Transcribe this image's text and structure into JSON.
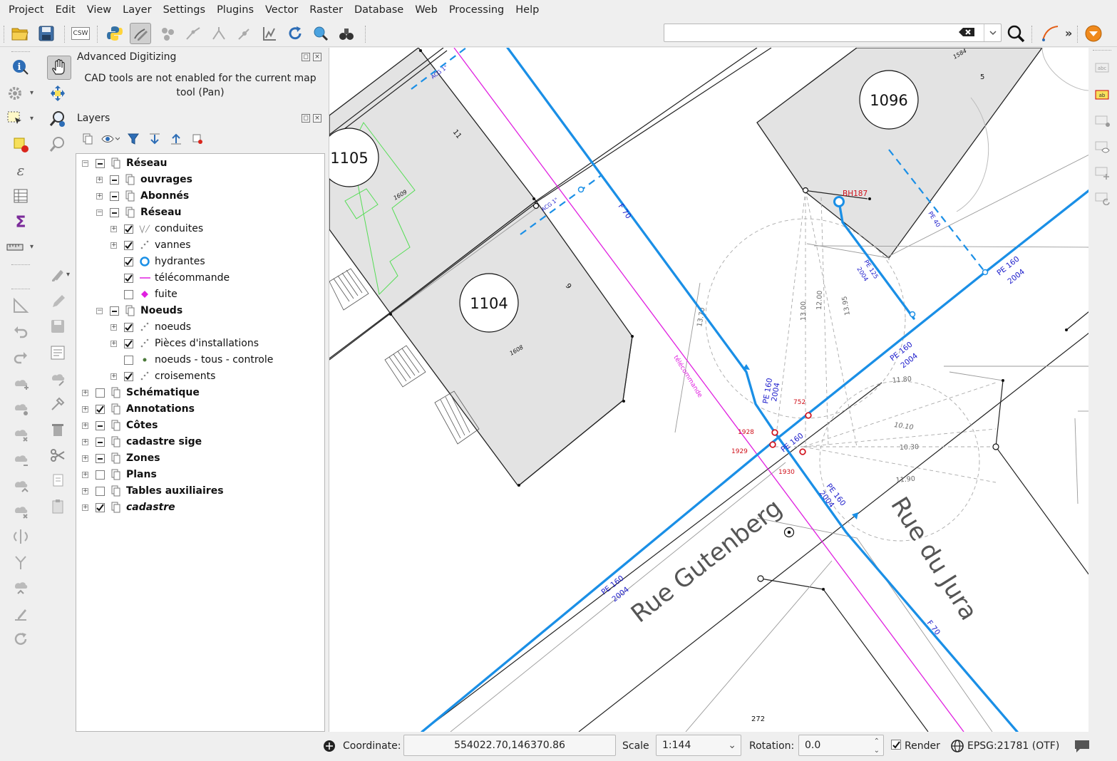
{
  "menu": [
    "Project",
    "Edit",
    "View",
    "Layer",
    "Settings",
    "Plugins",
    "Vector",
    "Raster",
    "Database",
    "Web",
    "Processing",
    "Help"
  ],
  "toolbar": {
    "csw_label": "CSW",
    "search_placeholder": "",
    "overflow": "»"
  },
  "advanced_digitizing": {
    "title": "Advanced Digitizing",
    "message": "CAD tools are not enabled for the current map tool (Pan)"
  },
  "layers_panel": {
    "title": "Layers",
    "rows": [
      {
        "label": "Réseau"
      },
      {
        "label": "ouvrages"
      },
      {
        "label": "Abonnés"
      },
      {
        "label": "Réseau"
      },
      {
        "label": "conduites"
      },
      {
        "label": "vannes"
      },
      {
        "label": "hydrantes"
      },
      {
        "label": "télécommande"
      },
      {
        "label": "fuite"
      },
      {
        "label": "Noeuds"
      },
      {
        "label": "noeuds"
      },
      {
        "label": "Pièces d'installations"
      },
      {
        "label": "noeuds - tous - controle"
      },
      {
        "label": "croisements"
      },
      {
        "label": "Schématique"
      },
      {
        "label": "Annotations"
      },
      {
        "label": "Côtes"
      },
      {
        "label": "cadastre sige"
      },
      {
        "label": "Zones"
      },
      {
        "label": "Plans"
      },
      {
        "label": "Tables auxiliaires"
      },
      {
        "label": "cadastre"
      }
    ]
  },
  "map": {
    "parcels": [
      "1105",
      "1104",
      "1096"
    ],
    "plot_numbers": [
      "11",
      "9",
      "5",
      "1609",
      "1608",
      "1584",
      "272"
    ],
    "streets": [
      "Rue Gutenberg",
      "Rue du Jura"
    ],
    "pipes": [
      "F 70",
      "PE 160",
      "2004",
      "PE 125",
      "PE 40",
      "ACG 1\""
    ],
    "hydrant": "BH187",
    "nodes": [
      "752",
      "1928",
      "1929",
      "1930"
    ],
    "line_label": "télécommande",
    "dimensions": [
      "13.70",
      "13.00",
      "12.00",
      "13.95",
      "11.80",
      "10.10",
      "10.30",
      "11.90"
    ],
    "colors": {
      "pipe": "#1a8fe6",
      "telecommande": "#e020e0",
      "node": "#d0101a",
      "parcel_fill": "#e3e3e3",
      "building_outline": "#55dd55"
    }
  },
  "status": {
    "coordinate_label": "Coordinate:",
    "coordinate_value": "554022.70,146370.86",
    "scale_label": "Scale",
    "scale_value": "1:144",
    "rotation_label": "Rotation:",
    "rotation_value": "0.0",
    "render_label": "Render",
    "crs": "EPSG:21781 (OTF)"
  }
}
